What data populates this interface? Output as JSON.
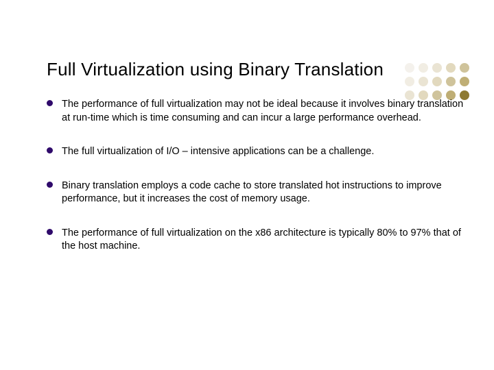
{
  "title": "Full Virtualization using Binary Translation",
  "bullets": [
    "The performance of full virtualization may not be ideal because it involves binary translation at run-time which is time consuming and can incur a large performance overhead.",
    "The full virtualization of I/O – intensive applications can be a challenge.",
    "Binary translation employs a code cache to store translated hot instructions to improve performance, but it increases the cost of memory usage.",
    "The performance of full virtualization on the x86 architecture is typically 80% to 97% that of the host machine."
  ],
  "decoration": {
    "dot_colors": [
      "#f4f1ec",
      "#f1ede3",
      "#eae4d3",
      "#e2d9be",
      "#cfc39b",
      "#f1ede3",
      "#eae4d3",
      "#e2d9be",
      "#cfc39b",
      "#bfae75",
      "#eae4d3",
      "#e2d9be",
      "#cfc39b",
      "#bfae75",
      "#8e7a32"
    ]
  }
}
